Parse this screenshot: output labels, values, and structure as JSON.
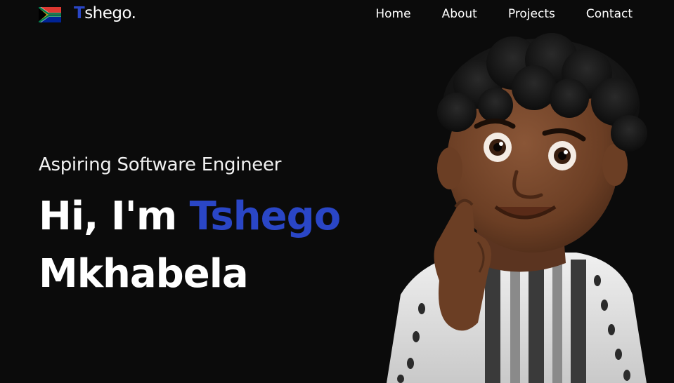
{
  "header": {
    "logo_initial": "T",
    "logo_rest": "shego.",
    "nav": [
      "Home",
      "About",
      "Projects",
      "Contact"
    ]
  },
  "hero": {
    "subtitle": "Aspiring Software Engineer",
    "greeting": "Hi, I'm ",
    "first_name": "Tshego",
    "last_name": "Mkhabela"
  },
  "colors": {
    "background": "#0b0b0b",
    "accent": "#2a46c6",
    "text": "#ffffff"
  },
  "icons": {
    "flag": "south-africa-flag-icon",
    "avatar": "memoji-avatar-illustration"
  }
}
